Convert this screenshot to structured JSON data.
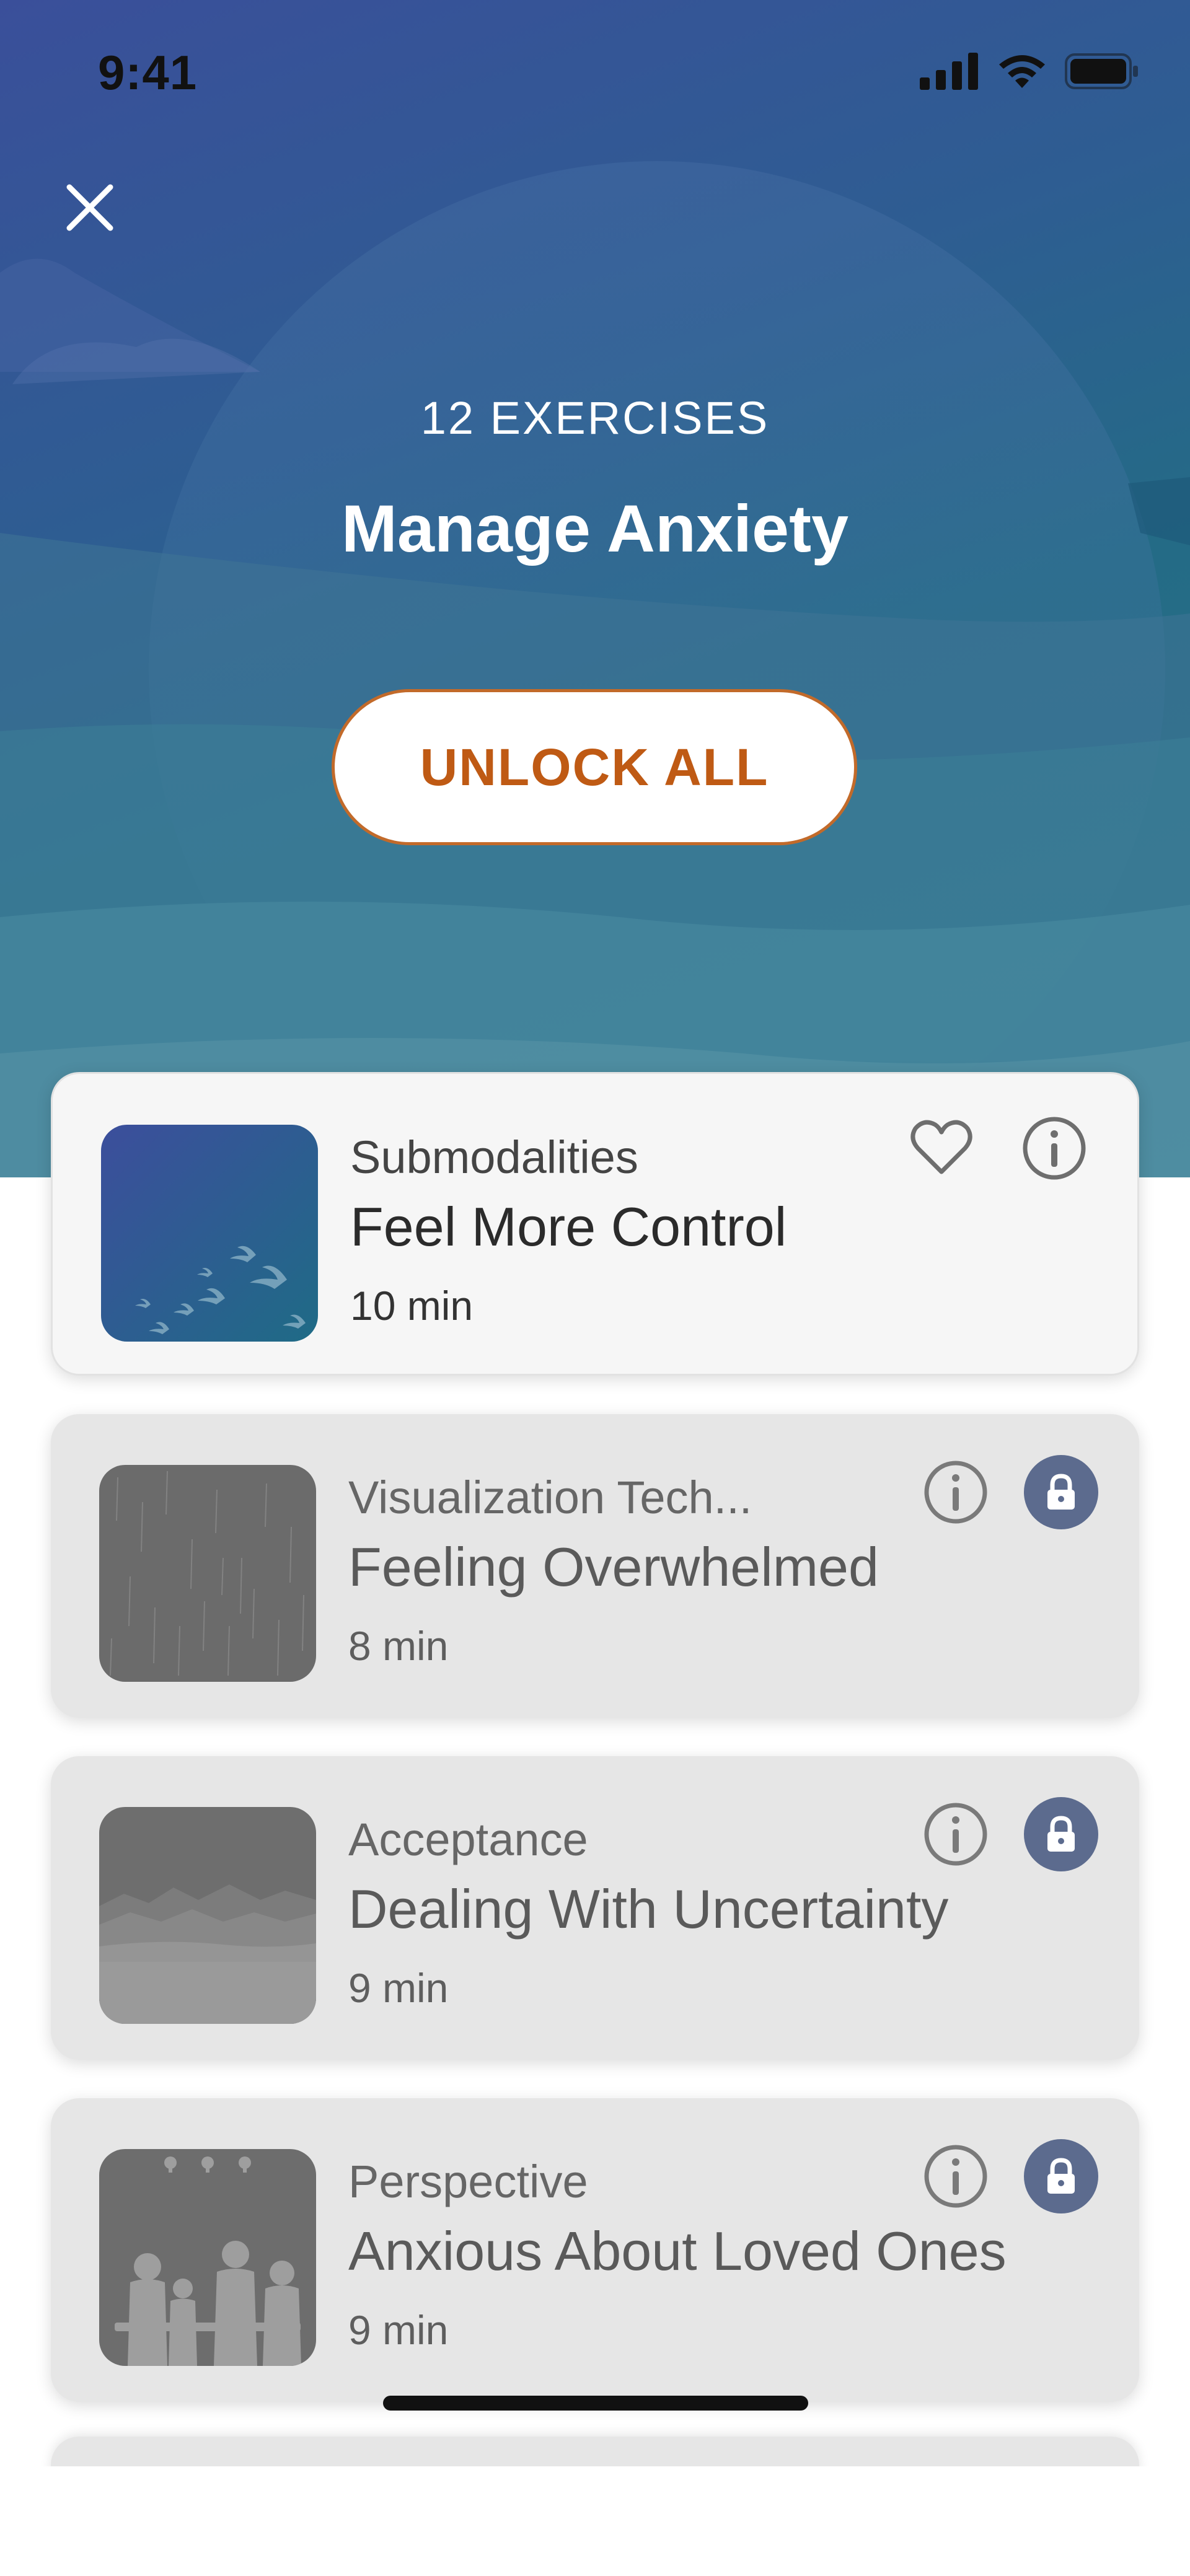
{
  "status_bar": {
    "time": "9:41"
  },
  "header": {
    "count_label": "12 EXERCISES",
    "title": "Manage Anxiety",
    "unlock_label": "UNLOCK ALL"
  },
  "exercises": [
    {
      "category": "Submodalities",
      "title": "Feel More Control",
      "duration": "10 min",
      "locked": false,
      "thumb": "birds"
    },
    {
      "category": "Visualization Tech...",
      "title": "Feeling Overwhelmed",
      "duration": "8 min",
      "locked": true,
      "thumb": "rain"
    },
    {
      "category": "Acceptance",
      "title": "Dealing With Uncertainty",
      "duration": "9 min",
      "locked": true,
      "thumb": "mountains"
    },
    {
      "category": "Perspective",
      "title": "Anxious About Loved Ones",
      "duration": "9 min",
      "locked": true,
      "thumb": "family"
    }
  ],
  "colors": {
    "accent": "#bf5a14",
    "lock_badge": "#5c6b8e",
    "hero_top": "#3a4f9a",
    "hero_bottom": "#2c7187"
  },
  "icons": {
    "close": "close-icon",
    "favorite": "heart-icon",
    "info": "info-icon",
    "lock": "lock-icon",
    "signal": "cellular-signal-icon",
    "wifi": "wifi-icon",
    "battery": "battery-icon"
  }
}
